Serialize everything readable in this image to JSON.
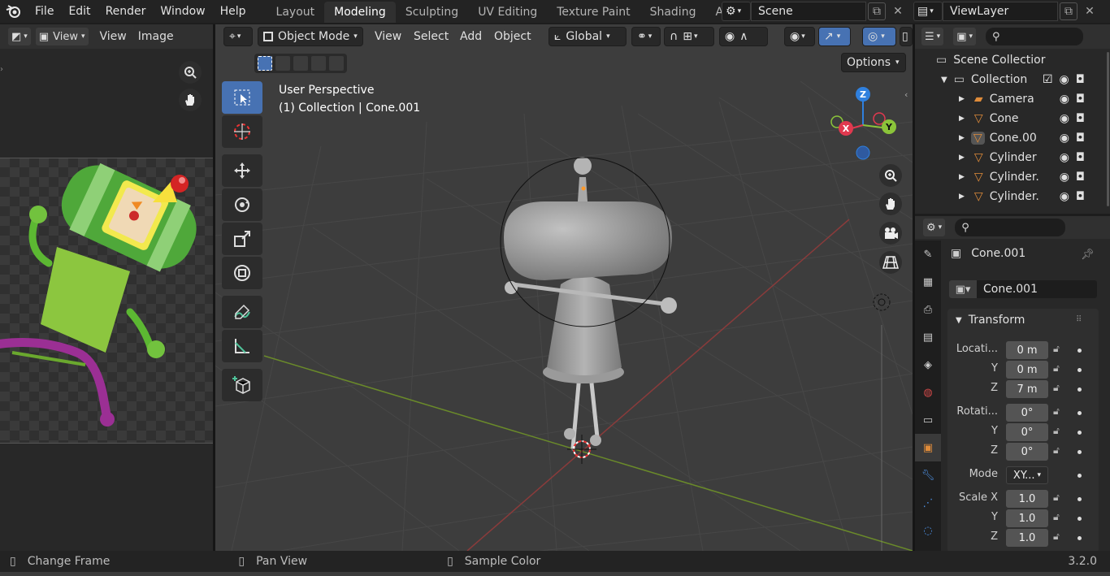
{
  "menubar": {
    "items": [
      "File",
      "Edit",
      "Render",
      "Window",
      "Help"
    ],
    "workspaces": [
      "Layout",
      "Modeling",
      "Sculpting",
      "UV Editing",
      "Texture Paint",
      "Shading",
      "Animatio"
    ],
    "active_workspace": "Modeling",
    "scene": "Scene",
    "view_layer": "ViewLayer"
  },
  "image_editor": {
    "view_label": "View",
    "menus": [
      "View",
      "Image"
    ]
  },
  "viewport": {
    "mode": "Object Mode",
    "menus": [
      "View",
      "Select",
      "Add",
      "Object"
    ],
    "orientation": "Global",
    "options_label": "Options",
    "perspective_label": "User Perspective",
    "collection_label": "(1) Collection | Cone.001",
    "gizmo": {
      "x": "X",
      "y": "Y",
      "z": "Z"
    }
  },
  "outliner": {
    "root": "Scene Collectior",
    "collection": "Collection",
    "items": [
      "Camera",
      "Cone",
      "Cone.00",
      "Cylinder",
      "Cylinder.",
      "Cylinder."
    ]
  },
  "properties": {
    "object_name": "Cone.001",
    "data_name": "Cone.001",
    "panel_title": "Transform",
    "location_label": "Locati...",
    "location": {
      "x": "0 m",
      "y": "0 m",
      "z": "7 m"
    },
    "rotation_label": "Rotati...",
    "rotation": {
      "x": "0°",
      "y": "0°",
      "z": "0°"
    },
    "mode_label": "Mode",
    "mode_value": "XY...",
    "scale_label": "Scale X",
    "scale": {
      "x": "1.0",
      "y": "1.0",
      "z": "1.0"
    },
    "axis_y": "Y",
    "axis_z": "Z"
  },
  "statusbar": {
    "left": "Change Frame",
    "middle": "Pan View",
    "right": "Sample Color",
    "version": "3.2.0"
  },
  "colors": {
    "accent": "#4772b3",
    "x_axis": "#e0394f",
    "y_axis": "#8bc43a",
    "z_axis": "#2f80de"
  }
}
